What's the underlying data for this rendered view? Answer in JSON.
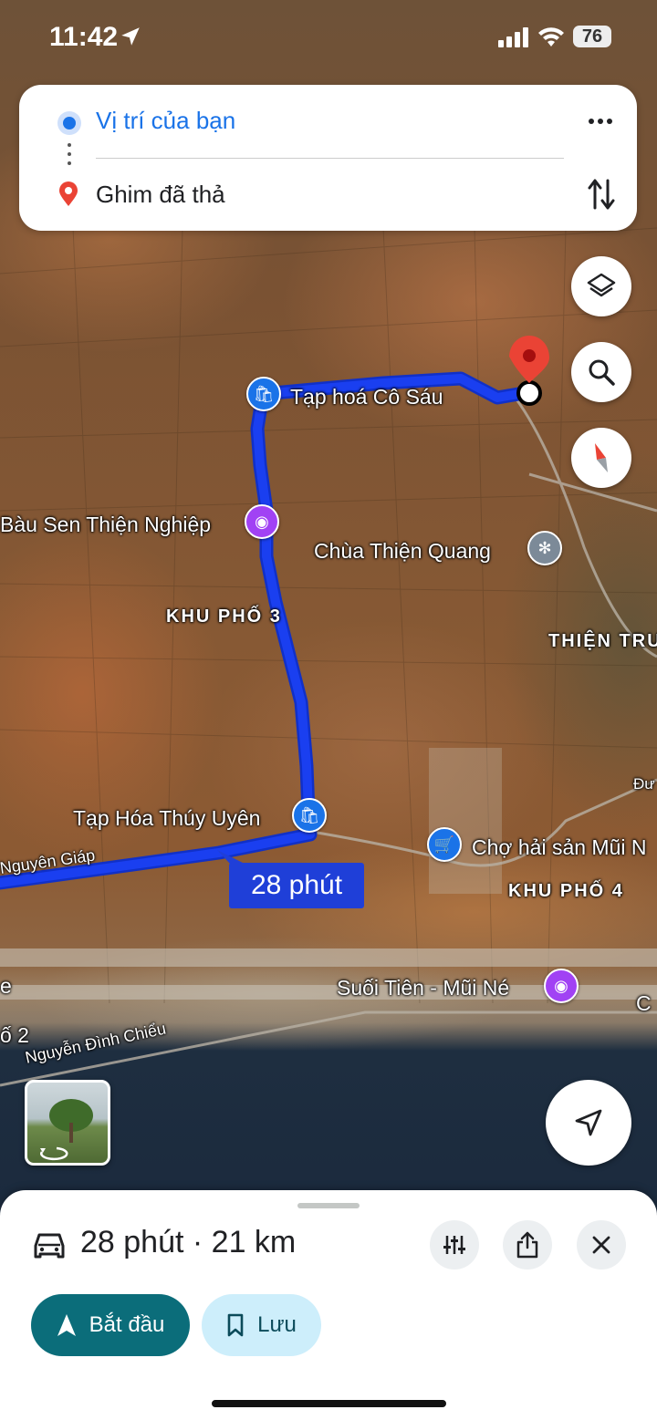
{
  "status_bar": {
    "time": "11:42",
    "battery": "76"
  },
  "route_card": {
    "origin": "Vị trí của bạn",
    "destination": "Ghim đã thả"
  },
  "map": {
    "pois": {
      "tap_hoa_co_sau": "Tạp hoá Cô Sáu",
      "bau_sen": "Bàu Sen Thiện Nghiệp",
      "chua_thien_quang": "Chùa Thiện Quang",
      "tap_hoa_thuy_uyen": "Tạp Hóa Thúy Uyên",
      "cho_hai_san": "Chợ hải sản Mũi N",
      "suoi_tien": "Suối Tiên - Mũi Né"
    },
    "areas": {
      "khu_pho_3": "KHU PHỐ 3",
      "khu_pho_4": "KHU PHỐ 4",
      "thien_tru": "THIỆN TRU"
    },
    "roads": {
      "nguyen_giap": "Nguyên Giáp",
      "nguyen_dinh_chieu": "Nguyễn Đình Chiểu"
    },
    "edge_fragments": {
      "left_e": "e",
      "left_o2": "ố 2",
      "right_du": "Đư",
      "right_c": "C"
    },
    "duration_tag": "28 phút"
  },
  "bottom_sheet": {
    "summary": "28 phút · 21 km",
    "start_label": "Bắt đầu",
    "save_label": "Lưu"
  },
  "colors": {
    "route": "#1a3ff0",
    "accent_blue": "#1a73e8",
    "start_button": "#0b6d7a",
    "save_button": "#cdeefb",
    "pin_red": "#ea4335"
  },
  "icons": [
    "location-arrow-icon",
    "signal-icon",
    "wifi-icon",
    "more-vert-icon",
    "swap-icon",
    "layers-icon",
    "search-icon",
    "compass-icon",
    "navigate-icon",
    "car-icon",
    "tune-icon",
    "share-icon",
    "close-icon",
    "bookmark-icon",
    "navigation-icon"
  ]
}
